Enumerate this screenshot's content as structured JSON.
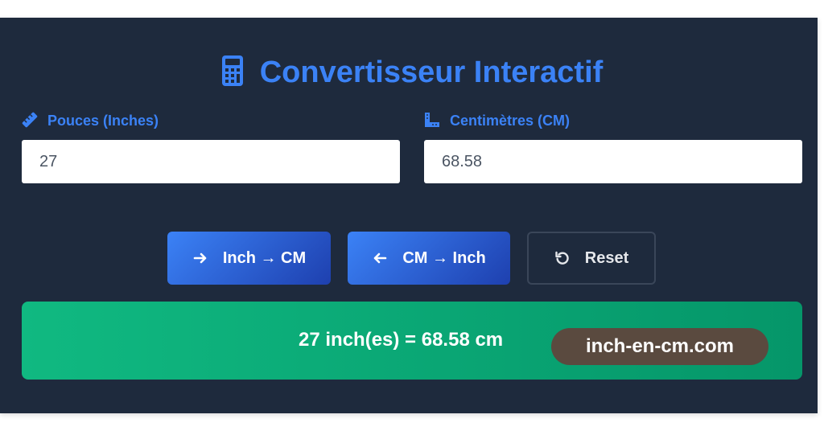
{
  "title": "Convertisseur Interactif",
  "icons": {
    "title": "calculator-icon",
    "inches_label": "ruler-icon",
    "cm_label": "ruler-combined-icon",
    "inch_to_cm": "arrow-right-icon",
    "cm_to_inch": "arrow-left-icon",
    "reset": "undo-icon"
  },
  "inches": {
    "label": "Pouces (Inches)",
    "value": "27"
  },
  "cm": {
    "label": "Centimètres (CM)",
    "value": "68.58"
  },
  "buttons": {
    "inch_to_cm": "Inch → CM",
    "cm_to_inch": "CM → Inch",
    "reset": "Reset"
  },
  "result": {
    "text": "27 inch(es) = 68.58 cm"
  },
  "watermark": "inch-en-cm.com",
  "colors": {
    "background": "#1e2a3d",
    "accent": "#3b82f6",
    "success": "#10b981",
    "watermark_bg": "#5a4a3f"
  }
}
